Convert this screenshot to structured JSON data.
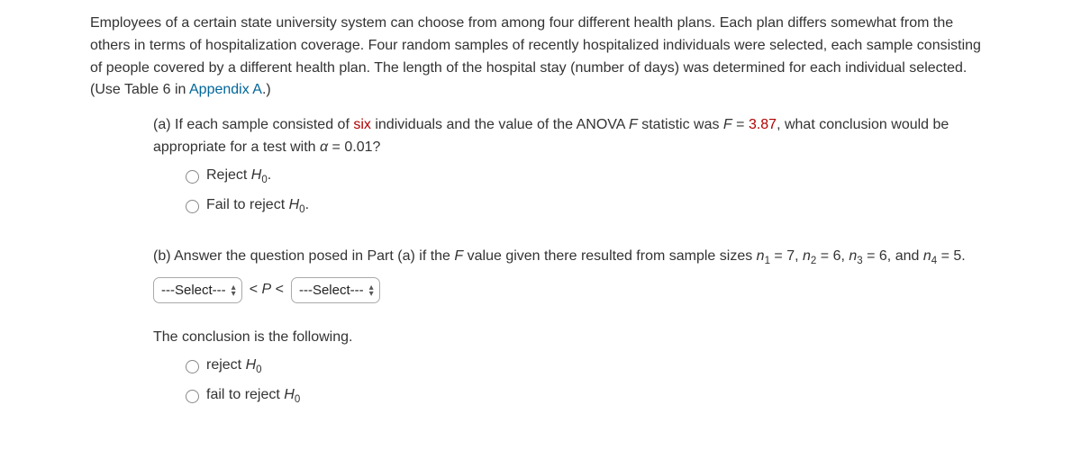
{
  "intro": {
    "text_before_link": "Employees of a certain state university system can choose from among four different health plans. Each plan differs somewhat from the others in terms of hospitalization coverage. Four random samples of recently hospitalized individuals were selected, each sample consisting of people covered by a different health plan. The length of the hospital stay (number of days) was determined for each individual selected. (Use Table 6 in ",
    "link_text": "Appendix A",
    "text_after_link": ".)"
  },
  "partA": {
    "prefix": "(a) If each sample consisted of ",
    "highlight": "six",
    "mid": " individuals and the value of the ANOVA ",
    "f_label": "F",
    "mid2": " statistic was ",
    "f_eq": "F",
    "eq_sign": " = ",
    "f_value": "3.87",
    "suffix": ", what conclusion would be appropriate for a test with ",
    "alpha": "α",
    "alpha_eq": " = 0.01?",
    "opt1_pre": "Reject ",
    "opt1_H": "H",
    "opt1_sub": "0",
    "opt1_dot": ".",
    "opt2_pre": "Fail to reject ",
    "opt2_H": "H",
    "opt2_sub": "0",
    "opt2_dot": "."
  },
  "partB": {
    "text1": "(b) Answer the question posed in Part (a) if the ",
    "f_label": "F",
    "text2": " value given there resulted from sample sizes ",
    "n1": "n",
    "n1_sub": "1",
    "n1_eq": " = 7, ",
    "n2": "n",
    "n2_sub": "2",
    "n2_eq": " = 6, ",
    "n3": "n",
    "n3_sub": "3",
    "n3_eq": " = 6, and ",
    "n4": "n",
    "n4_sub": "4",
    "n4_eq": " = 5.",
    "select1": "---Select---",
    "p_lt": "< ",
    "p_var": "P",
    "p_lt2": " <",
    "select2": "---Select---"
  },
  "conclusion": {
    "heading": "The conclusion is the following.",
    "opt1_pre": "reject ",
    "opt1_H": "H",
    "opt1_sub": "0",
    "opt2_pre": "fail to reject ",
    "opt2_H": "H",
    "opt2_sub": "0"
  }
}
